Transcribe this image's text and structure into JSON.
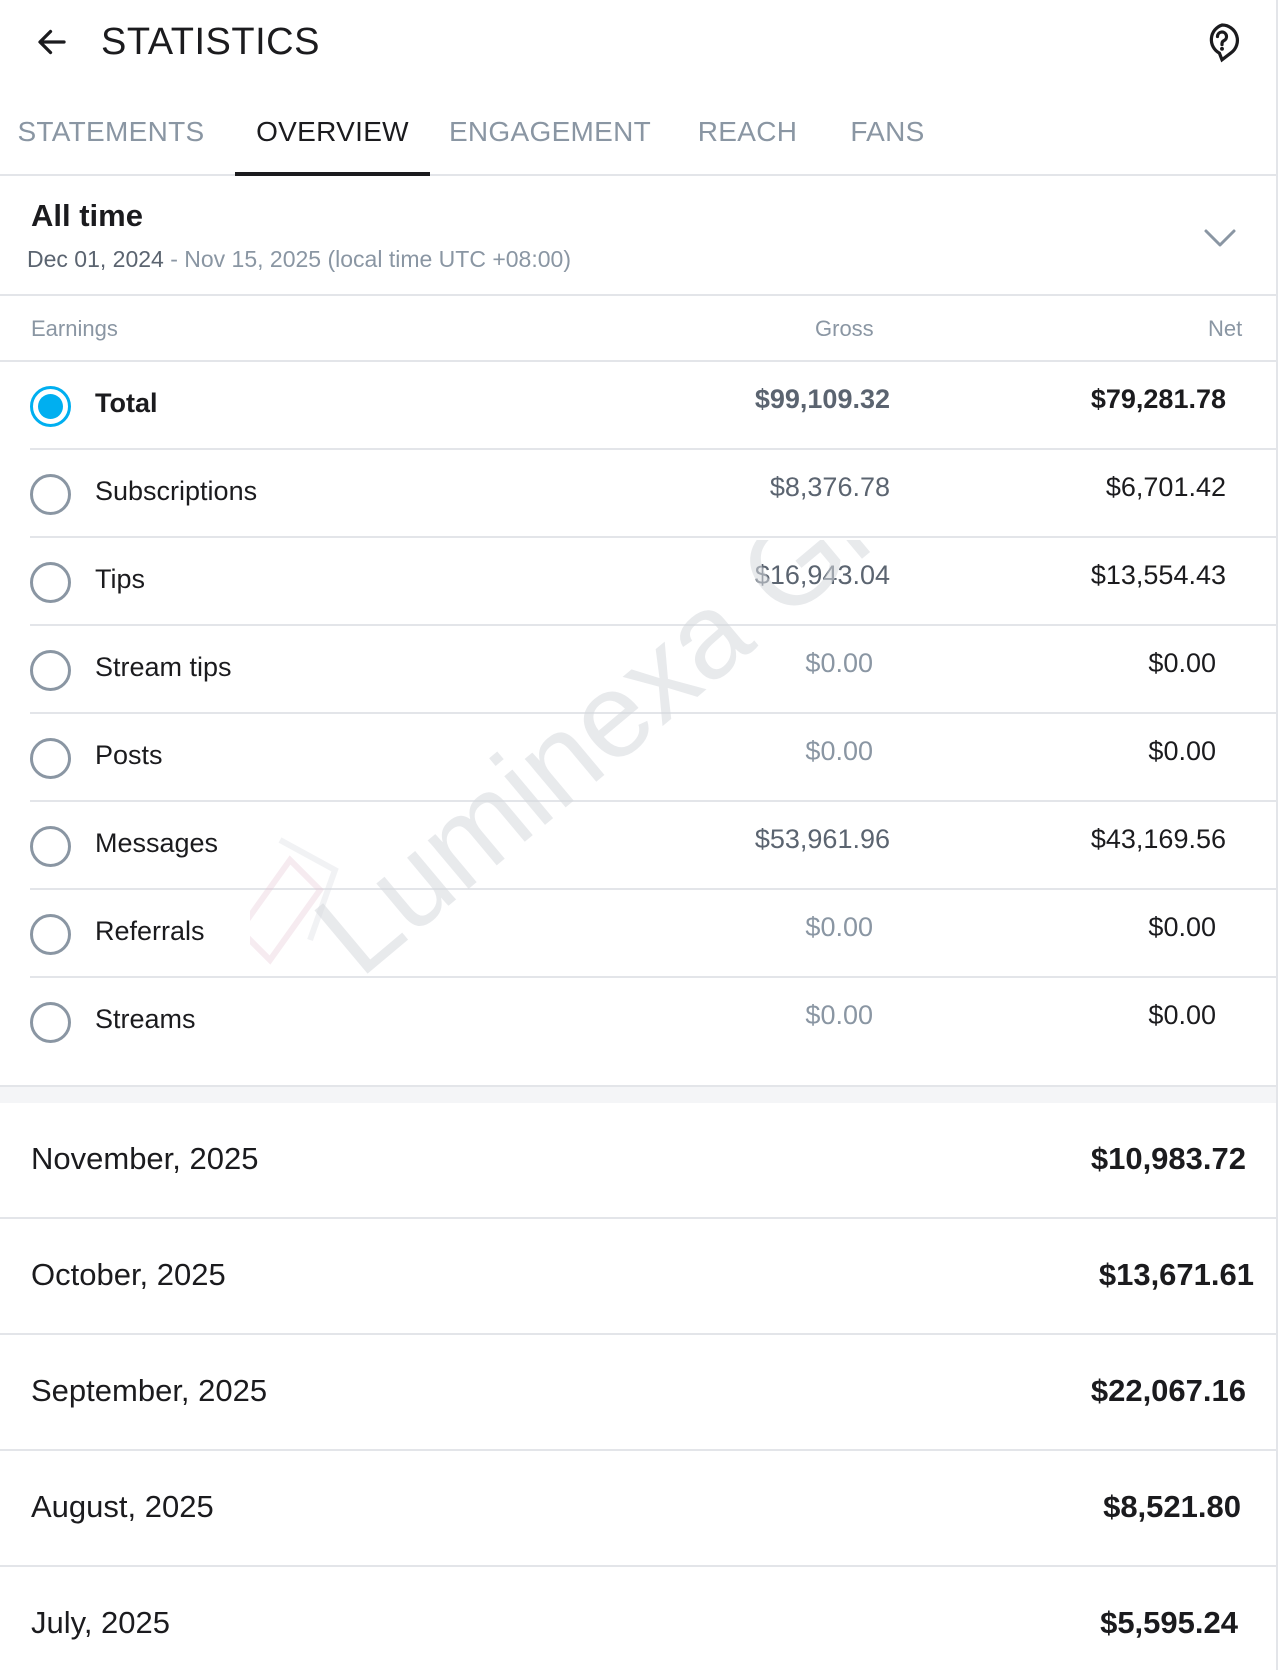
{
  "header": {
    "title": "STATISTICS",
    "back_icon": "arrow-left-icon",
    "help_icon": "question-circle-icon"
  },
  "tabs": [
    {
      "label": "STATEMENTS",
      "active": false
    },
    {
      "label": "OVERVIEW",
      "active": true
    },
    {
      "label": "ENGAGEMENT",
      "active": false
    },
    {
      "label": "REACH",
      "active": false
    },
    {
      "label": "FANS",
      "active": false
    }
  ],
  "period": {
    "label": "All time",
    "start": "Dec 01, 2024",
    "range_rest": " - Nov 15, 2025 (local time UTC +08:00)",
    "chevron_icon": "chevron-down-icon"
  },
  "table": {
    "col_earnings": "Earnings",
    "col_gross": "Gross",
    "col_net": "Net",
    "rows": [
      {
        "label": "Total",
        "gross": "$99,109.32",
        "net": "$79,281.78",
        "selected": true
      },
      {
        "label": "Subscriptions",
        "gross": "$8,376.78",
        "net": "$6,701.42",
        "selected": false
      },
      {
        "label": "Tips",
        "gross": "$16,943.04",
        "net": "$13,554.43",
        "selected": false
      },
      {
        "label": "Stream tips",
        "gross": "$0.00",
        "net": "$0.00",
        "selected": false
      },
      {
        "label": "Posts",
        "gross": "$0.00",
        "net": "$0.00",
        "selected": false
      },
      {
        "label": "Messages",
        "gross": "$53,961.96",
        "net": "$43,169.56",
        "selected": false
      },
      {
        "label": "Referrals",
        "gross": "$0.00",
        "net": "$0.00",
        "selected": false
      },
      {
        "label": "Streams",
        "gross": "$0.00",
        "net": "$0.00",
        "selected": false
      }
    ]
  },
  "months": [
    {
      "label": "November, 2025",
      "value": "$10,983.72"
    },
    {
      "label": "October, 2025",
      "value": "$13,671.61"
    },
    {
      "label": "September, 2025",
      "value": "$22,067.16"
    },
    {
      "label": "August, 2025",
      "value": "$8,521.80"
    },
    {
      "label": "July, 2025",
      "value": "$5,595.24"
    }
  ],
  "watermark": {
    "text": "Luminexa Group"
  },
  "colors": {
    "accent": "#00aff0",
    "muted": "#8a96a3",
    "divider": "#e3e5e9",
    "text": "#1b1b1e"
  }
}
